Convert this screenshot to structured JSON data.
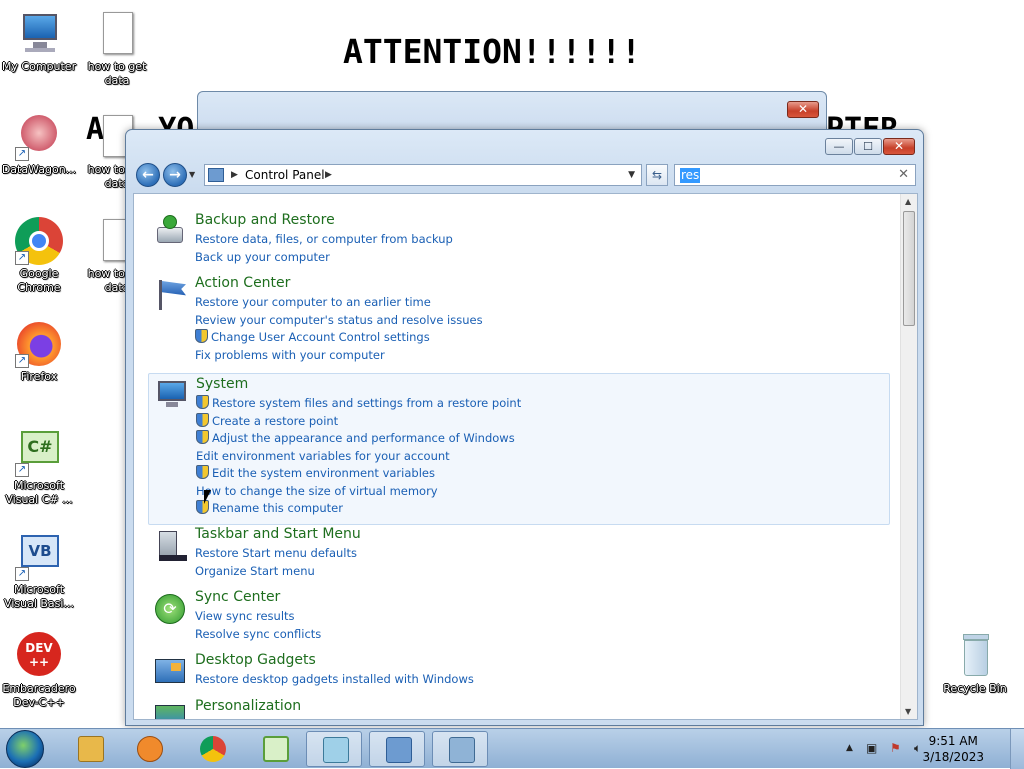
{
  "desktop": {
    "background_text": [
      "ATTENTION!!!!!!",
      "ALL YO",
      "PTER"
    ],
    "icons": [
      {
        "label": "My Computer",
        "icon": "computer-icon"
      },
      {
        "label": "how to get data",
        "icon": "text-document-icon"
      },
      {
        "label": "DataWagon...",
        "icon": "datawagon-icon"
      },
      {
        "label": "how to get data",
        "icon": "text-document-icon"
      },
      {
        "label": "Google Chrome",
        "icon": "chrome-icon"
      },
      {
        "label": "how to get data",
        "icon": "text-document-icon"
      },
      {
        "label": "Firefox",
        "icon": "firefox-icon"
      },
      {
        "label": "Microsoft Visual C# ...",
        "icon": "visual-csharp-icon"
      },
      {
        "label": "Microsoft Visual Basi...",
        "icon": "visual-basic-icon"
      },
      {
        "label": "Embarcadero Dev-C++",
        "icon": "dev-cpp-icon"
      },
      {
        "label": "Recycle Bin",
        "icon": "recycle-bin-icon"
      }
    ]
  },
  "back_window": {
    "close_label": "✕"
  },
  "control_panel": {
    "buttons": {
      "minimize": "—",
      "maximize": "☐",
      "close": "✕",
      "back": "←",
      "forward": "→",
      "refresh": "⇆"
    },
    "breadcrumb": {
      "root": "Control Panel"
    },
    "search": {
      "value": "res",
      "clear": "✕"
    },
    "groups": [
      {
        "title": "Backup and Restore",
        "icon": "backup-restore-icon",
        "links": [
          {
            "text": "Restore data, files, or computer from backup",
            "shield": false
          },
          {
            "text": "Back up your computer",
            "shield": false
          }
        ]
      },
      {
        "title": "Action Center",
        "icon": "action-center-flag-icon",
        "links": [
          {
            "text": "Restore your computer to an earlier time",
            "shield": false
          },
          {
            "text": "Review your computer's status and resolve issues",
            "shield": false
          },
          {
            "text": "Change User Account Control settings",
            "shield": true
          },
          {
            "text": "Fix problems with your computer",
            "shield": false
          }
        ]
      },
      {
        "title": "System",
        "icon": "system-computer-icon",
        "links": [
          {
            "text": "Restore system files and settings from a restore point",
            "shield": true
          },
          {
            "text": "Create a restore point",
            "shield": true
          },
          {
            "text": "Adjust the appearance and performance of Windows",
            "shield": true
          },
          {
            "text": "Edit environment variables for your account",
            "shield": false
          },
          {
            "text": "Edit the system environment variables",
            "shield": true
          },
          {
            "text": "How to change the size of virtual memory",
            "shield": false
          },
          {
            "text": "Rename this computer",
            "shield": true
          }
        ]
      },
      {
        "title": "Taskbar and Start Menu",
        "icon": "taskbar-icon",
        "links": [
          {
            "text": "Restore Start menu defaults",
            "shield": false
          },
          {
            "text": "Organize Start menu",
            "shield": false
          }
        ]
      },
      {
        "title": "Sync Center",
        "icon": "sync-center-icon",
        "links": [
          {
            "text": "View sync results",
            "shield": false
          },
          {
            "text": "Resolve sync conflicts",
            "shield": false
          }
        ]
      },
      {
        "title": "Desktop Gadgets",
        "icon": "desktop-gadgets-icon",
        "links": [
          {
            "text": "Restore desktop gadgets installed with Windows",
            "shield": false
          }
        ]
      },
      {
        "title": "Personalization",
        "icon": "personalization-icon",
        "links": []
      }
    ]
  },
  "taskbar": {
    "items": [
      {
        "icon": "windows-explorer-icon",
        "color": "#e8b84a"
      },
      {
        "icon": "media-player-icon",
        "color": "#f08a2c"
      },
      {
        "icon": "chrome-icon",
        "color": "#db4437"
      },
      {
        "icon": "visual-csharp-icon",
        "color": "#5a9e3a"
      },
      {
        "icon": "notepad-icon",
        "color": "#9fd0e8"
      },
      {
        "icon": "control-panel-icon",
        "color": "#6d9bd0"
      },
      {
        "icon": "backup-restore-icon",
        "color": "#8fb3d6"
      }
    ],
    "clock": {
      "time": "9:51 AM",
      "date": "3/18/2023"
    }
  }
}
